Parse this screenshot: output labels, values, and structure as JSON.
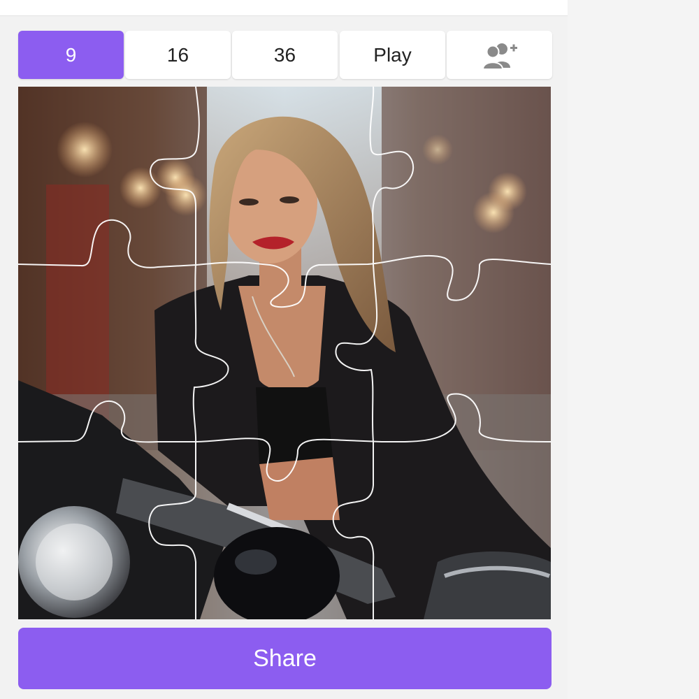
{
  "tabs": [
    {
      "label": "9",
      "active": true
    },
    {
      "label": "16",
      "active": false
    },
    {
      "label": "36",
      "active": false
    },
    {
      "label": "Play",
      "active": false
    },
    {
      "icon": "add-users-icon",
      "active": false
    }
  ],
  "share_label": "Share",
  "colors": {
    "accent": "#8c5df0",
    "tab_bg": "#ffffff",
    "page_bg": "#f2f2f2"
  }
}
